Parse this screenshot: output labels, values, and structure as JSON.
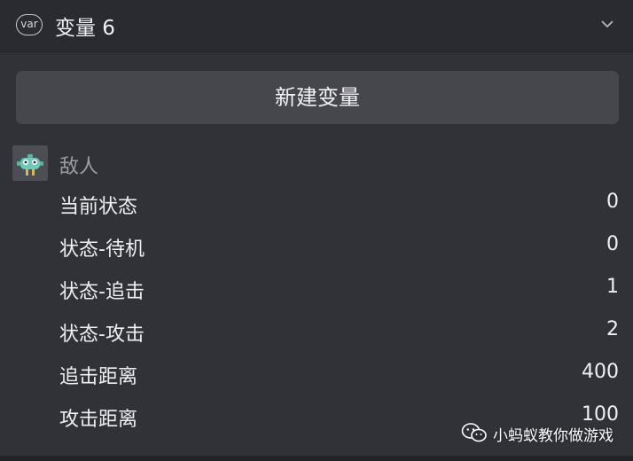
{
  "header": {
    "badge": "var",
    "title": "变量 6",
    "toggle_icon": "chevron-down-icon"
  },
  "actions": {
    "new_variable_label": "新建变量"
  },
  "object": {
    "name": "敌人",
    "avatar_icon": "robot-avatar-icon"
  },
  "variables": [
    {
      "name": "当前状态",
      "value": "0"
    },
    {
      "name": "状态-待机",
      "value": "0"
    },
    {
      "name": "状态-追击",
      "value": "1"
    },
    {
      "name": "状态-攻击",
      "value": "2"
    },
    {
      "name": "追击距离",
      "value": "400"
    },
    {
      "name": "攻击距离",
      "value": "100"
    }
  ],
  "watermark": {
    "text": "小蚂蚁教你做游戏",
    "icon": "wechat-icon"
  },
  "colors": {
    "background": "#313237",
    "button": "#46474d",
    "avatar_body": "#6ec9b6"
  }
}
